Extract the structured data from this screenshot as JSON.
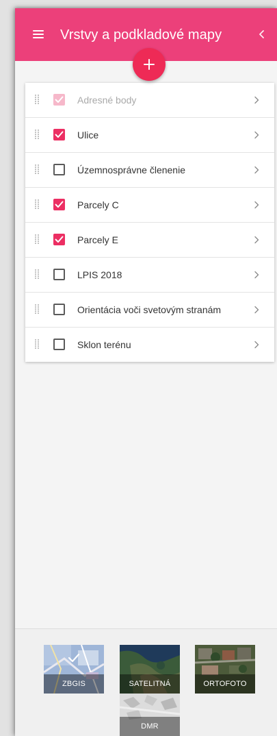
{
  "header": {
    "title": "Vrstvy a podkladové mapy",
    "accent_color": "#ec407a",
    "menu_icon": "hamburger-menu-icon",
    "collapse_icon": "chevron-left-icon",
    "add_icon": "plus-icon"
  },
  "layers": [
    {
      "label": "Adresné body",
      "checked": true,
      "disabled": true
    },
    {
      "label": "Ulice",
      "checked": true,
      "disabled": false
    },
    {
      "label": "Územnosprávne členenie",
      "checked": false,
      "disabled": false
    },
    {
      "label": "Parcely C",
      "checked": true,
      "disabled": false
    },
    {
      "label": "Parcely E",
      "checked": true,
      "disabled": false
    },
    {
      "label": "LPIS 2018",
      "checked": false,
      "disabled": false
    },
    {
      "label": "Orientácia voči svetovým stranám",
      "checked": false,
      "disabled": false
    },
    {
      "label": "Sklon terénu",
      "checked": false,
      "disabled": false
    }
  ],
  "basemaps": [
    {
      "label": "ZBGIS",
      "selected": true
    },
    {
      "label": "SATELITNÁ",
      "selected": false
    },
    {
      "label": "ORTOFOTO",
      "selected": false
    },
    {
      "label": "DMR",
      "selected": false
    }
  ]
}
